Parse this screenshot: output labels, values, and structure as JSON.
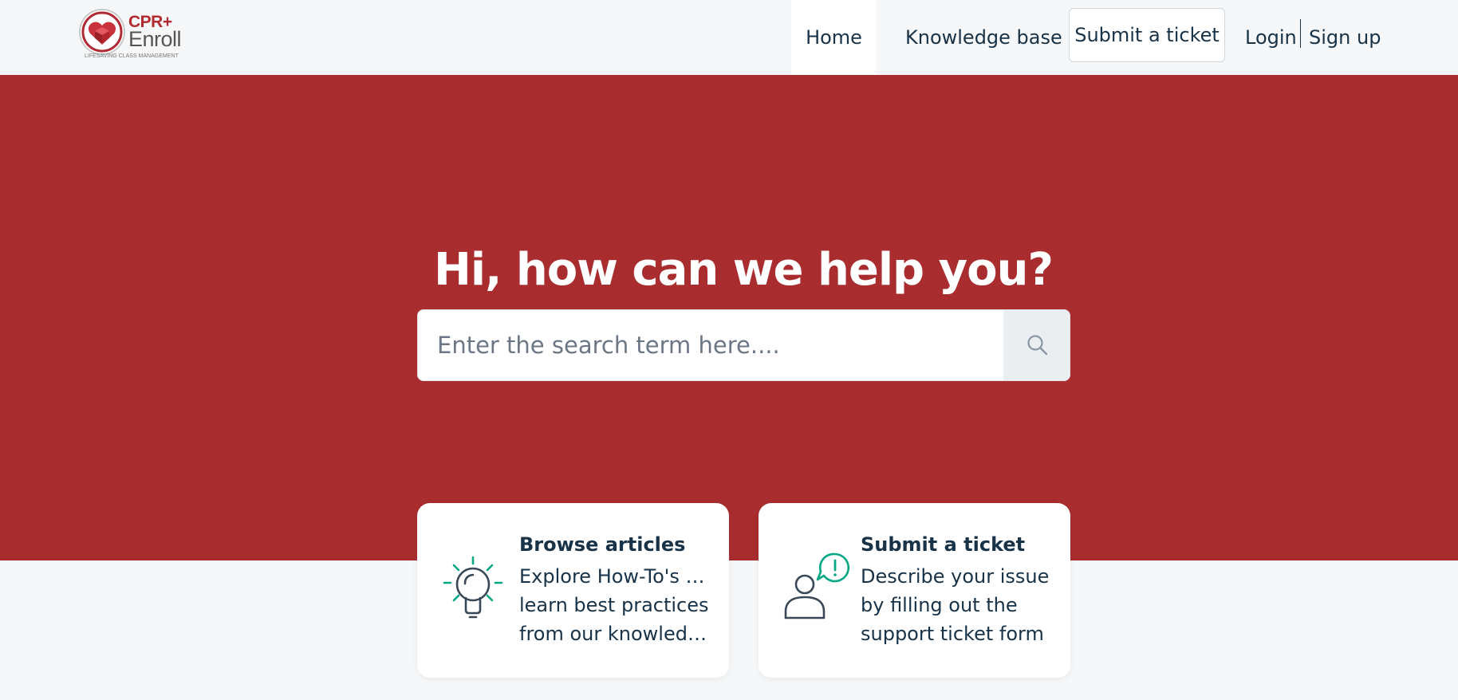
{
  "header": {
    "logo": {
      "brand_top": "CPR+",
      "brand_bottom": "Enroll",
      "tagline": "LIFESAVING CLASS MANAGEMENT"
    },
    "nav": {
      "home": "Home",
      "knowledge_base": "Knowledge base",
      "submit_ticket": "Submit a ticket",
      "login": "Login",
      "signup": "Sign up"
    }
  },
  "hero": {
    "title": "Hi, how can we help you?",
    "search_placeholder": "Enter the search term here....",
    "search_icon": "search-icon"
  },
  "cards": {
    "browse": {
      "icon": "lightbulb-icon",
      "title": "Browse articles",
      "desc_lines": [
        "Explore How-To's and",
        "learn best practices",
        "from our knowledge..."
      ]
    },
    "ticket": {
      "icon": "person-alert-icon",
      "title": "Submit a ticket",
      "desc_lines": [
        "Describe your issue",
        "by filling out the",
        "support ticket form"
      ]
    }
  },
  "colors": {
    "hero_bg": "#a92d2f",
    "page_bg": "#f5f7f9",
    "text": "#183247",
    "accent_green": "#02a883"
  }
}
